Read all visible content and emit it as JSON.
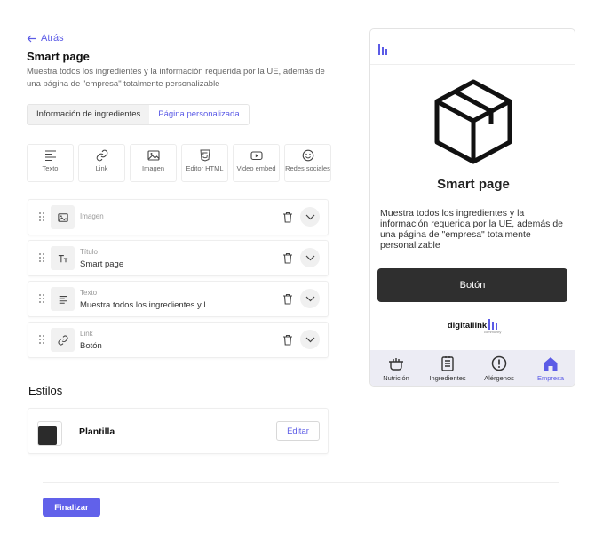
{
  "header": {
    "back_label": "Atrás",
    "title": "Smart page",
    "description": "Muestra todos los ingredientes y la información requerida por la UE, además de una página de \"empresa\" totalmente personalizable"
  },
  "tabs": [
    {
      "label": "Información de ingredientes",
      "active": false
    },
    {
      "label": "Página personalizada",
      "active": true
    }
  ],
  "tools": [
    {
      "label": "Texto",
      "icon": "text-icon"
    },
    {
      "label": "Link",
      "icon": "link-icon"
    },
    {
      "label": "Imagen",
      "icon": "image-icon"
    },
    {
      "label": "Editor HTML",
      "icon": "html5-icon"
    },
    {
      "label": "Video embed",
      "icon": "video-icon"
    },
    {
      "label": "Redes sociales",
      "icon": "smiley-icon"
    }
  ],
  "blocks": [
    {
      "type": "Imagen",
      "value": "",
      "icon": "image-icon"
    },
    {
      "type": "Título",
      "value": "Smart page",
      "icon": "heading-icon"
    },
    {
      "type": "Texto",
      "value": "Muestra todos los ingredientes y l...",
      "icon": "text-icon"
    },
    {
      "type": "Link",
      "value": "Botón",
      "icon": "link-icon"
    }
  ],
  "styles": {
    "title": "Estilos",
    "template_name": "Plantilla",
    "template_color": "#2b2b2b",
    "edit_label": "Editar"
  },
  "footer": {
    "finish_label": "Finalizar"
  },
  "preview": {
    "title": "Smart page",
    "description": "Muestra todos los ingredientes y la información requerida por la UE, además de una página de \"empresa\" totalmente personalizable",
    "button_label": "Botón",
    "brand_text": "digitallink",
    "brand_sub": "community",
    "nav": [
      {
        "label": "Nutrición",
        "icon": "pot-icon",
        "active": false
      },
      {
        "label": "Ingredientes",
        "icon": "list-icon",
        "active": false
      },
      {
        "label": "Alérgenos",
        "icon": "alert-icon",
        "active": false
      },
      {
        "label": "Empresa",
        "icon": "home-icon",
        "active": true
      }
    ]
  },
  "colors": {
    "accent": "#5b5be6",
    "dark": "#2f2f2f"
  }
}
